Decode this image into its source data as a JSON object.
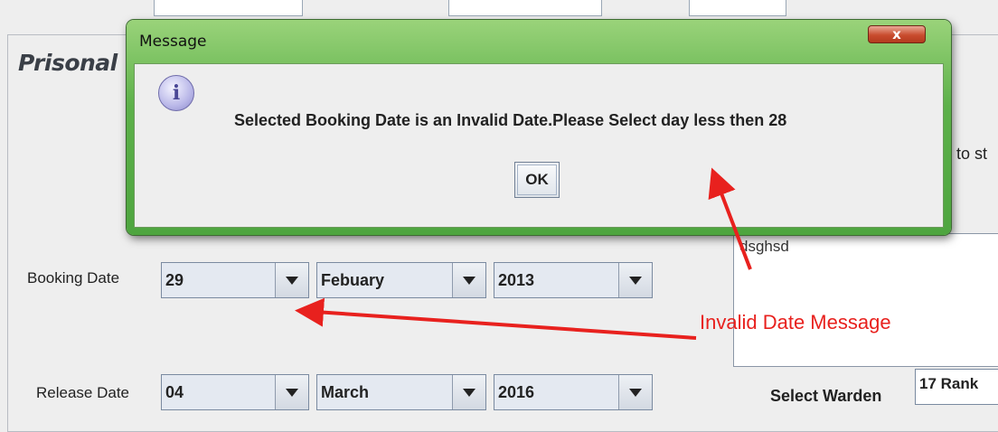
{
  "form": {
    "panel_title": "Prisonal",
    "partial_text": "to st",
    "booking": {
      "label": "Booking Date",
      "day": "29",
      "month": "Febuary",
      "year": "2013"
    },
    "release": {
      "label": "Release Date",
      "day": "04",
      "month": "March",
      "year": "2016"
    },
    "notes_text": "dsghsd",
    "warden": {
      "label": "Select Warden",
      "value": "17 Rank"
    }
  },
  "dialog": {
    "title": "Message",
    "close_label": "x",
    "icon": "info-icon",
    "message": "Selected Booking Date is an Invalid Date.Please Select day less then 28",
    "ok_label": "OK"
  },
  "annotation": {
    "text": "Invalid Date Message",
    "color": "#e8211e"
  }
}
